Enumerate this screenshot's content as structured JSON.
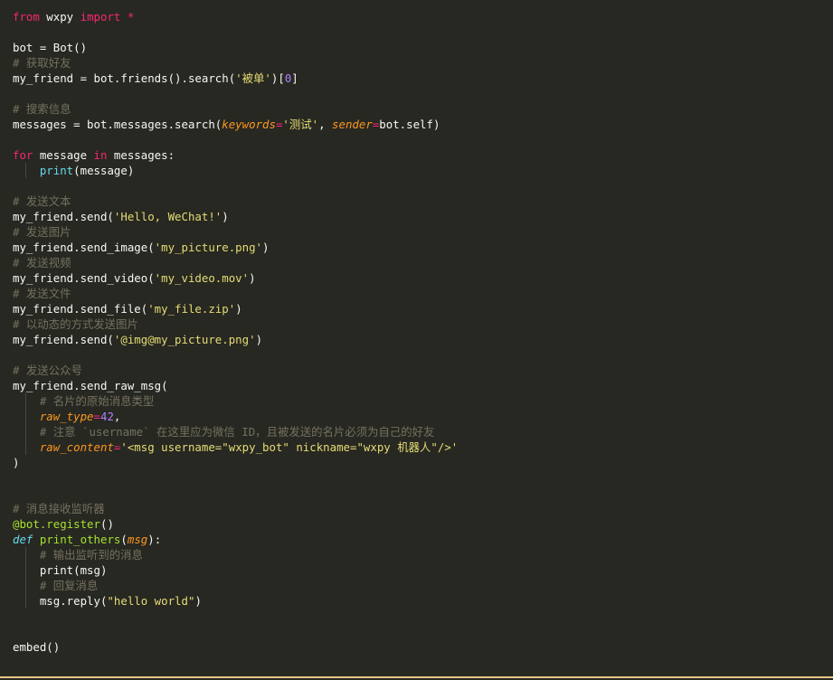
{
  "editor": {
    "theme_colors": {
      "background": "#272822",
      "text": "#f8f8f2",
      "keyword": "#f92672",
      "string": "#e6db74",
      "number": "#ae81ff",
      "comment": "#75715e",
      "argument": "#fd971f",
      "function": "#a6e22e",
      "status_rule": "#e8c887"
    },
    "lines": {
      "l1": {
        "kw1": "from",
        "mod": " wxpy ",
        "kw2": "import",
        "rest": " *"
      },
      "l3": {
        "text": "bot = Bot()"
      },
      "l4": {
        "comment": "# 获取好友"
      },
      "l5": {
        "pre": "my_friend = bot.friends().search(",
        "str": "'被单'",
        "mid": ")[",
        "num": "0",
        "post": "]"
      },
      "l7": {
        "comment": "# 搜索信息"
      },
      "l8": {
        "pre": "messages = bot.messages.search(",
        "arg1": "keywords",
        "eq1": "=",
        "str": "'测试'",
        "comma": ", ",
        "arg2": "sender",
        "eq2": "=",
        "post": "bot.self)"
      },
      "l10": {
        "kw1": "for",
        "mid1": " message ",
        "kw2": "in",
        "post": " messages:"
      },
      "l11": {
        "indent": "    ",
        "fn": "print",
        "post": "(message)"
      },
      "l13": {
        "comment": "# 发送文本"
      },
      "l14": {
        "pre": "my_friend.send(",
        "str": "'Hello, WeChat!'",
        "post": ")"
      },
      "l15": {
        "comment": "# 发送图片"
      },
      "l16": {
        "pre": "my_friend.send_image(",
        "str": "'my_picture.png'",
        "post": ")"
      },
      "l17": {
        "comment": "# 发送视频"
      },
      "l18": {
        "pre": "my_friend.send_video(",
        "str": "'my_video.mov'",
        "post": ")"
      },
      "l19": {
        "comment": "# 发送文件"
      },
      "l20": {
        "pre": "my_friend.send_file(",
        "str": "'my_file.zip'",
        "post": ")"
      },
      "l21": {
        "comment": "# 以动态的方式发送图片"
      },
      "l22": {
        "pre": "my_friend.send(",
        "str": "'@img@my_picture.png'",
        "post": ")"
      },
      "l24": {
        "comment": "# 发送公众号"
      },
      "l25": {
        "text": "my_friend.send_raw_msg("
      },
      "l26": {
        "indent": "    ",
        "comment": "# 名片的原始消息类型"
      },
      "l27": {
        "indent": "    ",
        "arg": "raw_type",
        "eq": "=",
        "num": "42",
        "post": ","
      },
      "l28": {
        "indent": "    ",
        "comment": "# 注意 `username` 在这里应为微信 ID，且被发送的名片必须为自己的好友"
      },
      "l29": {
        "indent": "    ",
        "arg": "raw_content",
        "eq": "=",
        "str": "'<msg username=\"wxpy_bot\" nickname=\"wxpy 机器人\"/>'"
      },
      "l30": {
        "text": ")"
      },
      "l33": {
        "comment": "# 消息接收监听器"
      },
      "l34": {
        "deco": "@bot.register",
        "post": "()"
      },
      "l35": {
        "kw": "def",
        "sp": " ",
        "fn": "print_others",
        "open": "(",
        "arg": "msg",
        "close": "):"
      },
      "l36": {
        "indent": "    ",
        "comment": "# 输出监听到的消息"
      },
      "l37": {
        "indent": "    ",
        "text": "print(msg)"
      },
      "l38": {
        "indent": "    ",
        "comment": "# 回复消息"
      },
      "l39": {
        "indent": "    ",
        "pre": "msg.reply(",
        "str": "\"hello world\"",
        "post": ")"
      },
      "l42": {
        "text": "embed()"
      }
    }
  }
}
